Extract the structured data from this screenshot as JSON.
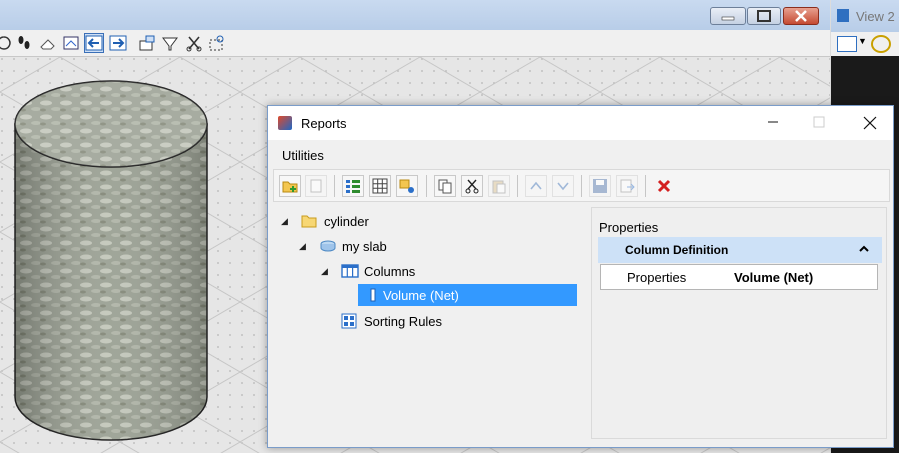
{
  "main_window": {
    "controls": {
      "minimize_icon": "minimize-icon",
      "maximize_icon": "maximize-icon",
      "close_icon": "close-icon"
    }
  },
  "side_view": {
    "title": "View 2 -"
  },
  "dialog": {
    "title": "Reports",
    "menu": {
      "utilities": "Utilities"
    },
    "tree": {
      "items": [
        {
          "label": "cylinder",
          "icon": "folder-icon"
        },
        {
          "label": "my slab",
          "icon": "report-icon"
        },
        {
          "label": "Columns",
          "icon": "columns-icon"
        },
        {
          "label": "Volume (Net)",
          "icon": "column-item-icon",
          "selected": true
        },
        {
          "label": "Sorting Rules",
          "icon": "sorting-rules-icon"
        }
      ]
    },
    "properties": {
      "heading": "Properties",
      "section": "Column Definition",
      "rows": [
        {
          "name": "Properties",
          "value": "Volume (Net)"
        }
      ]
    },
    "accent": "#3399ff"
  }
}
